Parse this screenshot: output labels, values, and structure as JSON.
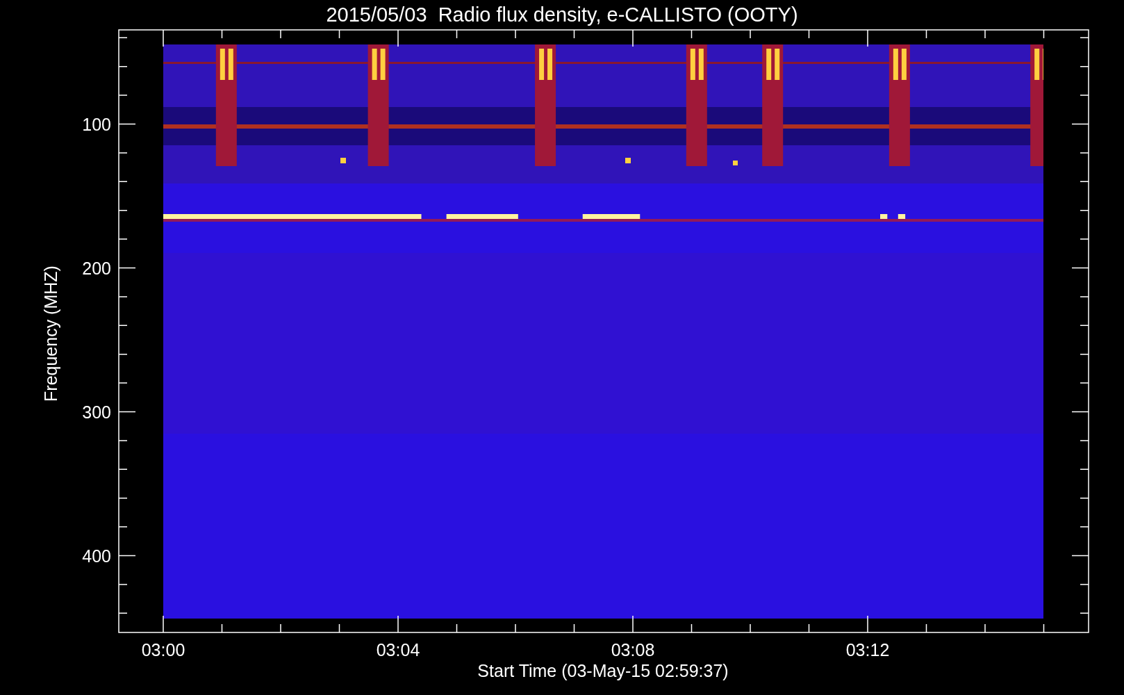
{
  "title": "2015/05/03  Radio flux density, e-CALLISTO (OOTY)",
  "y_axis": {
    "label": "Frequency (MHZ)",
    "ticks": [
      "100",
      "200",
      "300",
      "400"
    ]
  },
  "x_axis": {
    "label": "Start Time (03-May-15 02:59:37)",
    "ticks": [
      "03:00",
      "03:04",
      "03:08",
      "03:12"
    ]
  }
}
